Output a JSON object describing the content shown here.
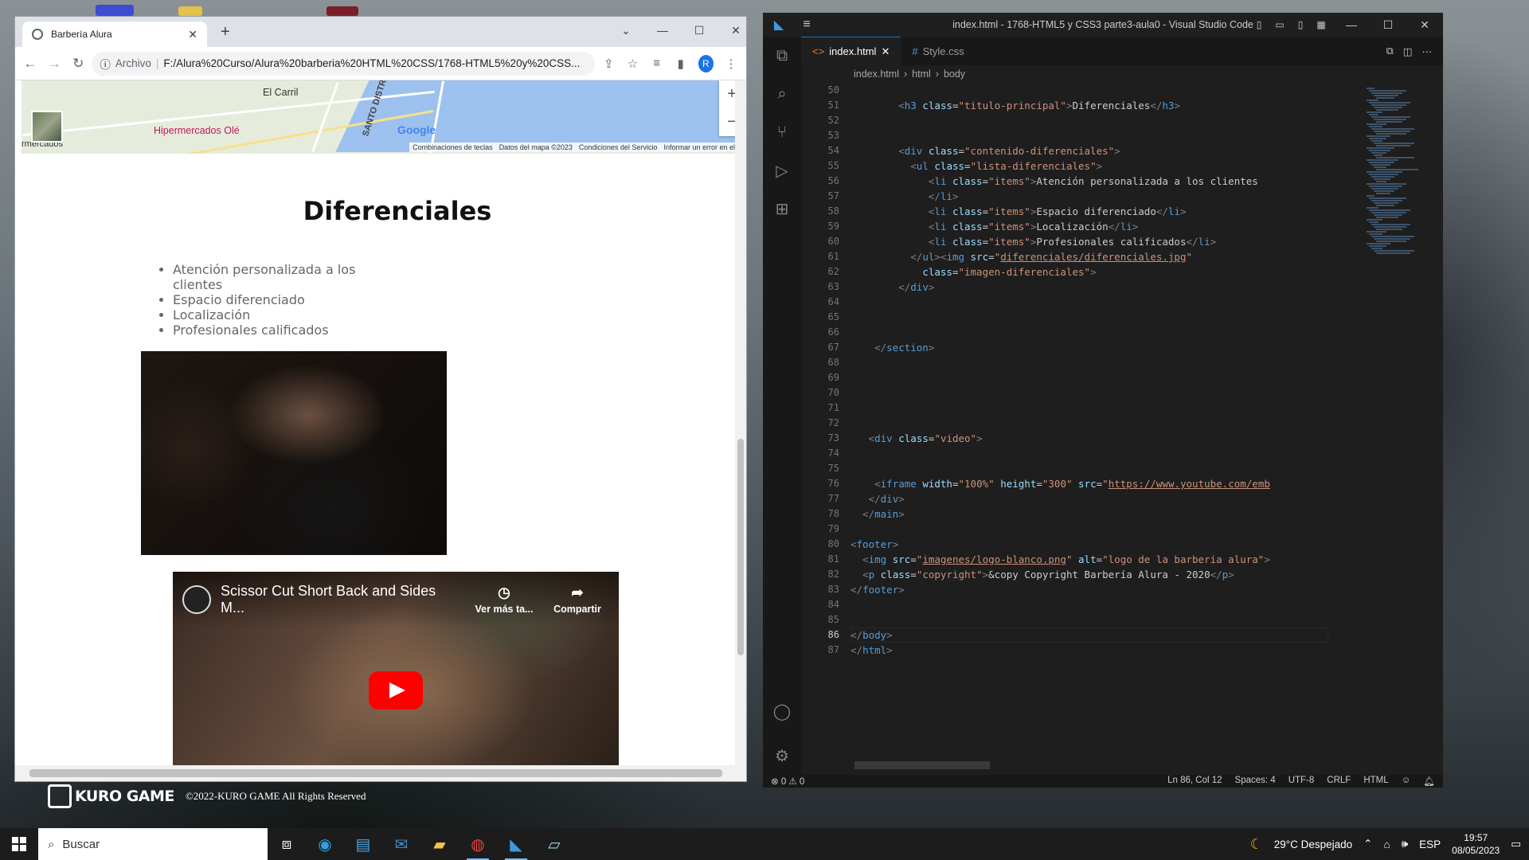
{
  "desktop": {
    "kuro_logo": "KURO GAME",
    "kuro_copy": "©2022-KURO GAME All Rights Reserved"
  },
  "chrome": {
    "tab_title": "Barbería Alura",
    "scheme_label": "Archivo",
    "url": "F:/Alura%20Curso/Alura%20barberia%20HTML%20CSS/1768-HTML5%20y%20CSS...",
    "avatar_letter": "R",
    "map": {
      "labels": [
        "El Carril",
        "Hipermercados Olé",
        "SANTO DISTRITO",
        "rmercados"
      ],
      "google": "Google",
      "footer": [
        "Combinaciones de teclas",
        "Datos del mapa ©2023",
        "Condiciones del Servicio",
        "Informar un error en el"
      ]
    },
    "page": {
      "heading": "Diferenciales",
      "items": [
        "Atención personalizada a los clientes",
        "Espacio diferenciado",
        "Localización",
        "Profesionales calificados"
      ],
      "video": {
        "title": "Scissor Cut Short Back and Sides M...",
        "watch_later": "Ver más ta...",
        "share": "Compartir"
      }
    }
  },
  "vscode": {
    "title": "index.html - 1768-HTML5 y CSS3 parte3-aula0 - Visual Studio Code",
    "tabs": [
      {
        "label": "index.html",
        "icon": "<>"
      },
      {
        "label": "Style.css",
        "icon": "#"
      }
    ],
    "breadcrumb": [
      "index.html",
      "html",
      "body"
    ],
    "lines": [
      {
        "n": "50",
        "html": ""
      },
      {
        "n": "51",
        "html": "<span class='br'>        &lt;</span><span class='tg'>h3</span> <span class='at'>class</span>=<span class='st'>\"titulo-principal\"</span><span class='br'>&gt;</span>Diferenciales<span class='br'>&lt;/</span><span class='tg'>h3</span><span class='br'>&gt;</span>"
      },
      {
        "n": "52",
        "html": ""
      },
      {
        "n": "53",
        "html": ""
      },
      {
        "n": "54",
        "html": "<span class='br'>        &lt;</span><span class='tg'>div</span> <span class='at'>class</span>=<span class='st'>\"contenido-diferenciales\"</span><span class='br'>&gt;</span>"
      },
      {
        "n": "55",
        "html": "<span class='br'>          &lt;</span><span class='tg'>ul</span> <span class='at'>class</span>=<span class='st'>\"lista-diferenciales\"</span><span class='br'>&gt;</span>"
      },
      {
        "n": "56",
        "html": "<span class='br'>             &lt;</span><span class='tg'>li</span> <span class='at'>class</span>=<span class='st'>\"items\"</span><span class='br'>&gt;</span>Atención personalizada a los clientes"
      },
      {
        "n": "57",
        "html": "<span class='br'>             &lt;/</span><span class='tg'>li</span><span class='br'>&gt;</span>"
      },
      {
        "n": "58",
        "html": "<span class='br'>             &lt;</span><span class='tg'>li</span> <span class='at'>class</span>=<span class='st'>\"items\"</span><span class='br'>&gt;</span>Espacio diferenciado<span class='br'>&lt;/</span><span class='tg'>li</span><span class='br'>&gt;</span>"
      },
      {
        "n": "59",
        "html": "<span class='br'>             &lt;</span><span class='tg'>li</span> <span class='at'>class</span>=<span class='st'>\"items\"</span><span class='br'>&gt;</span>Localización<span class='br'>&lt;/</span><span class='tg'>li</span><span class='br'>&gt;</span>"
      },
      {
        "n": "60",
        "html": "<span class='br'>             &lt;</span><span class='tg'>li</span> <span class='at'>class</span>=<span class='st'>\"items\"</span><span class='br'>&gt;</span>Profesionales calificados<span class='br'>&lt;/</span><span class='tg'>li</span><span class='br'>&gt;</span>"
      },
      {
        "n": "61",
        "html": "<span class='br'>          &lt;/</span><span class='tg'>ul</span><span class='br'>&gt;&lt;</span><span class='tg'>img</span> <span class='at'>src</span>=<span class='st'>\"</span><span class='lk'>diferenciales/diferenciales.jpg</span><span class='st'>\"</span>"
      },
      {
        "n": "62",
        "html": "            <span class='at'>class</span>=<span class='st'>\"imagen-diferenciales\"</span><span class='br'>&gt;</span>"
      },
      {
        "n": "63",
        "html": "<span class='br'>        &lt;/</span><span class='tg'>div</span><span class='br'>&gt;</span>"
      },
      {
        "n": "64",
        "html": ""
      },
      {
        "n": "65",
        "html": ""
      },
      {
        "n": "66",
        "html": ""
      },
      {
        "n": "67",
        "html": "<span class='br'>    &lt;/</span><span class='tg'>section</span><span class='br'>&gt;</span>"
      },
      {
        "n": "68",
        "html": ""
      },
      {
        "n": "69",
        "html": ""
      },
      {
        "n": "70",
        "html": ""
      },
      {
        "n": "71",
        "html": ""
      },
      {
        "n": "72",
        "html": ""
      },
      {
        "n": "73",
        "html": "<span class='br'>   &lt;</span><span class='tg'>div</span> <span class='at'>class</span>=<span class='st'>\"video\"</span><span class='br'>&gt;</span>"
      },
      {
        "n": "74",
        "html": ""
      },
      {
        "n": "75",
        "html": ""
      },
      {
        "n": "76",
        "html": "<span class='br'>    &lt;</span><span class='tg'>iframe</span> <span class='at'>width</span>=<span class='st'>\"100%\"</span> <span class='at'>height</span>=<span class='st'>\"300\"</span> <span class='at'>src</span>=<span class='st'>\"</span><span class='lk'>https://www.youtube.com/emb</span>"
      },
      {
        "n": "77",
        "html": "<span class='br'>   &lt;/</span><span class='tg'>div</span><span class='br'>&gt;</span>"
      },
      {
        "n": "78",
        "html": "<span class='br'>  &lt;/</span><span class='tg'>main</span><span class='br'>&gt;</span>"
      },
      {
        "n": "79",
        "html": ""
      },
      {
        "n": "80",
        "html": "<span class='br'>&lt;</span><span class='tg'>footer</span><span class='br'>&gt;</span>"
      },
      {
        "n": "81",
        "html": "<span class='br'>  &lt;</span><span class='tg'>img</span> <span class='at'>src</span>=<span class='st'>\"</span><span class='lk'>imagenes/logo-blanco.png</span><span class='st'>\"</span> <span class='at'>alt</span>=<span class='st'>\"logo de la barberia alura\"</span><span class='br'>&gt;</span>"
      },
      {
        "n": "82",
        "html": "<span class='br'>  &lt;</span><span class='tg'>p</span> <span class='at'>class</span>=<span class='st'>\"copyright\"</span><span class='br'>&gt;</span>&amp;copy Copyright Barbería Alura - 2020<span class='br'>&lt;/</span><span class='tg'>p</span><span class='br'>&gt;</span>"
      },
      {
        "n": "83",
        "html": "<span class='br'>&lt;/</span><span class='tg'>footer</span><span class='br'>&gt;</span>"
      },
      {
        "n": "84",
        "html": ""
      },
      {
        "n": "85",
        "html": ""
      },
      {
        "n": "86",
        "html": "<span class='br'>&lt;/</span><span class='tg'>body</span><span class='br'>&gt;</span>"
      },
      {
        "n": "87",
        "html": "<span class='br'>&lt;/</span><span class='tg'>html</span><span class='br'>&gt;</span>"
      }
    ],
    "status": {
      "problems": "⊗ 0 ⚠ 0",
      "position": "Ln 86, Col 12",
      "spaces": "Spaces: 4",
      "encoding": "UTF-8",
      "eol": "CRLF",
      "language": "HTML"
    }
  },
  "taskbar": {
    "search": "Buscar",
    "weather": "29°C  Despejado",
    "lang": "ESP",
    "time": "19:57",
    "date": "08/05/2023"
  }
}
